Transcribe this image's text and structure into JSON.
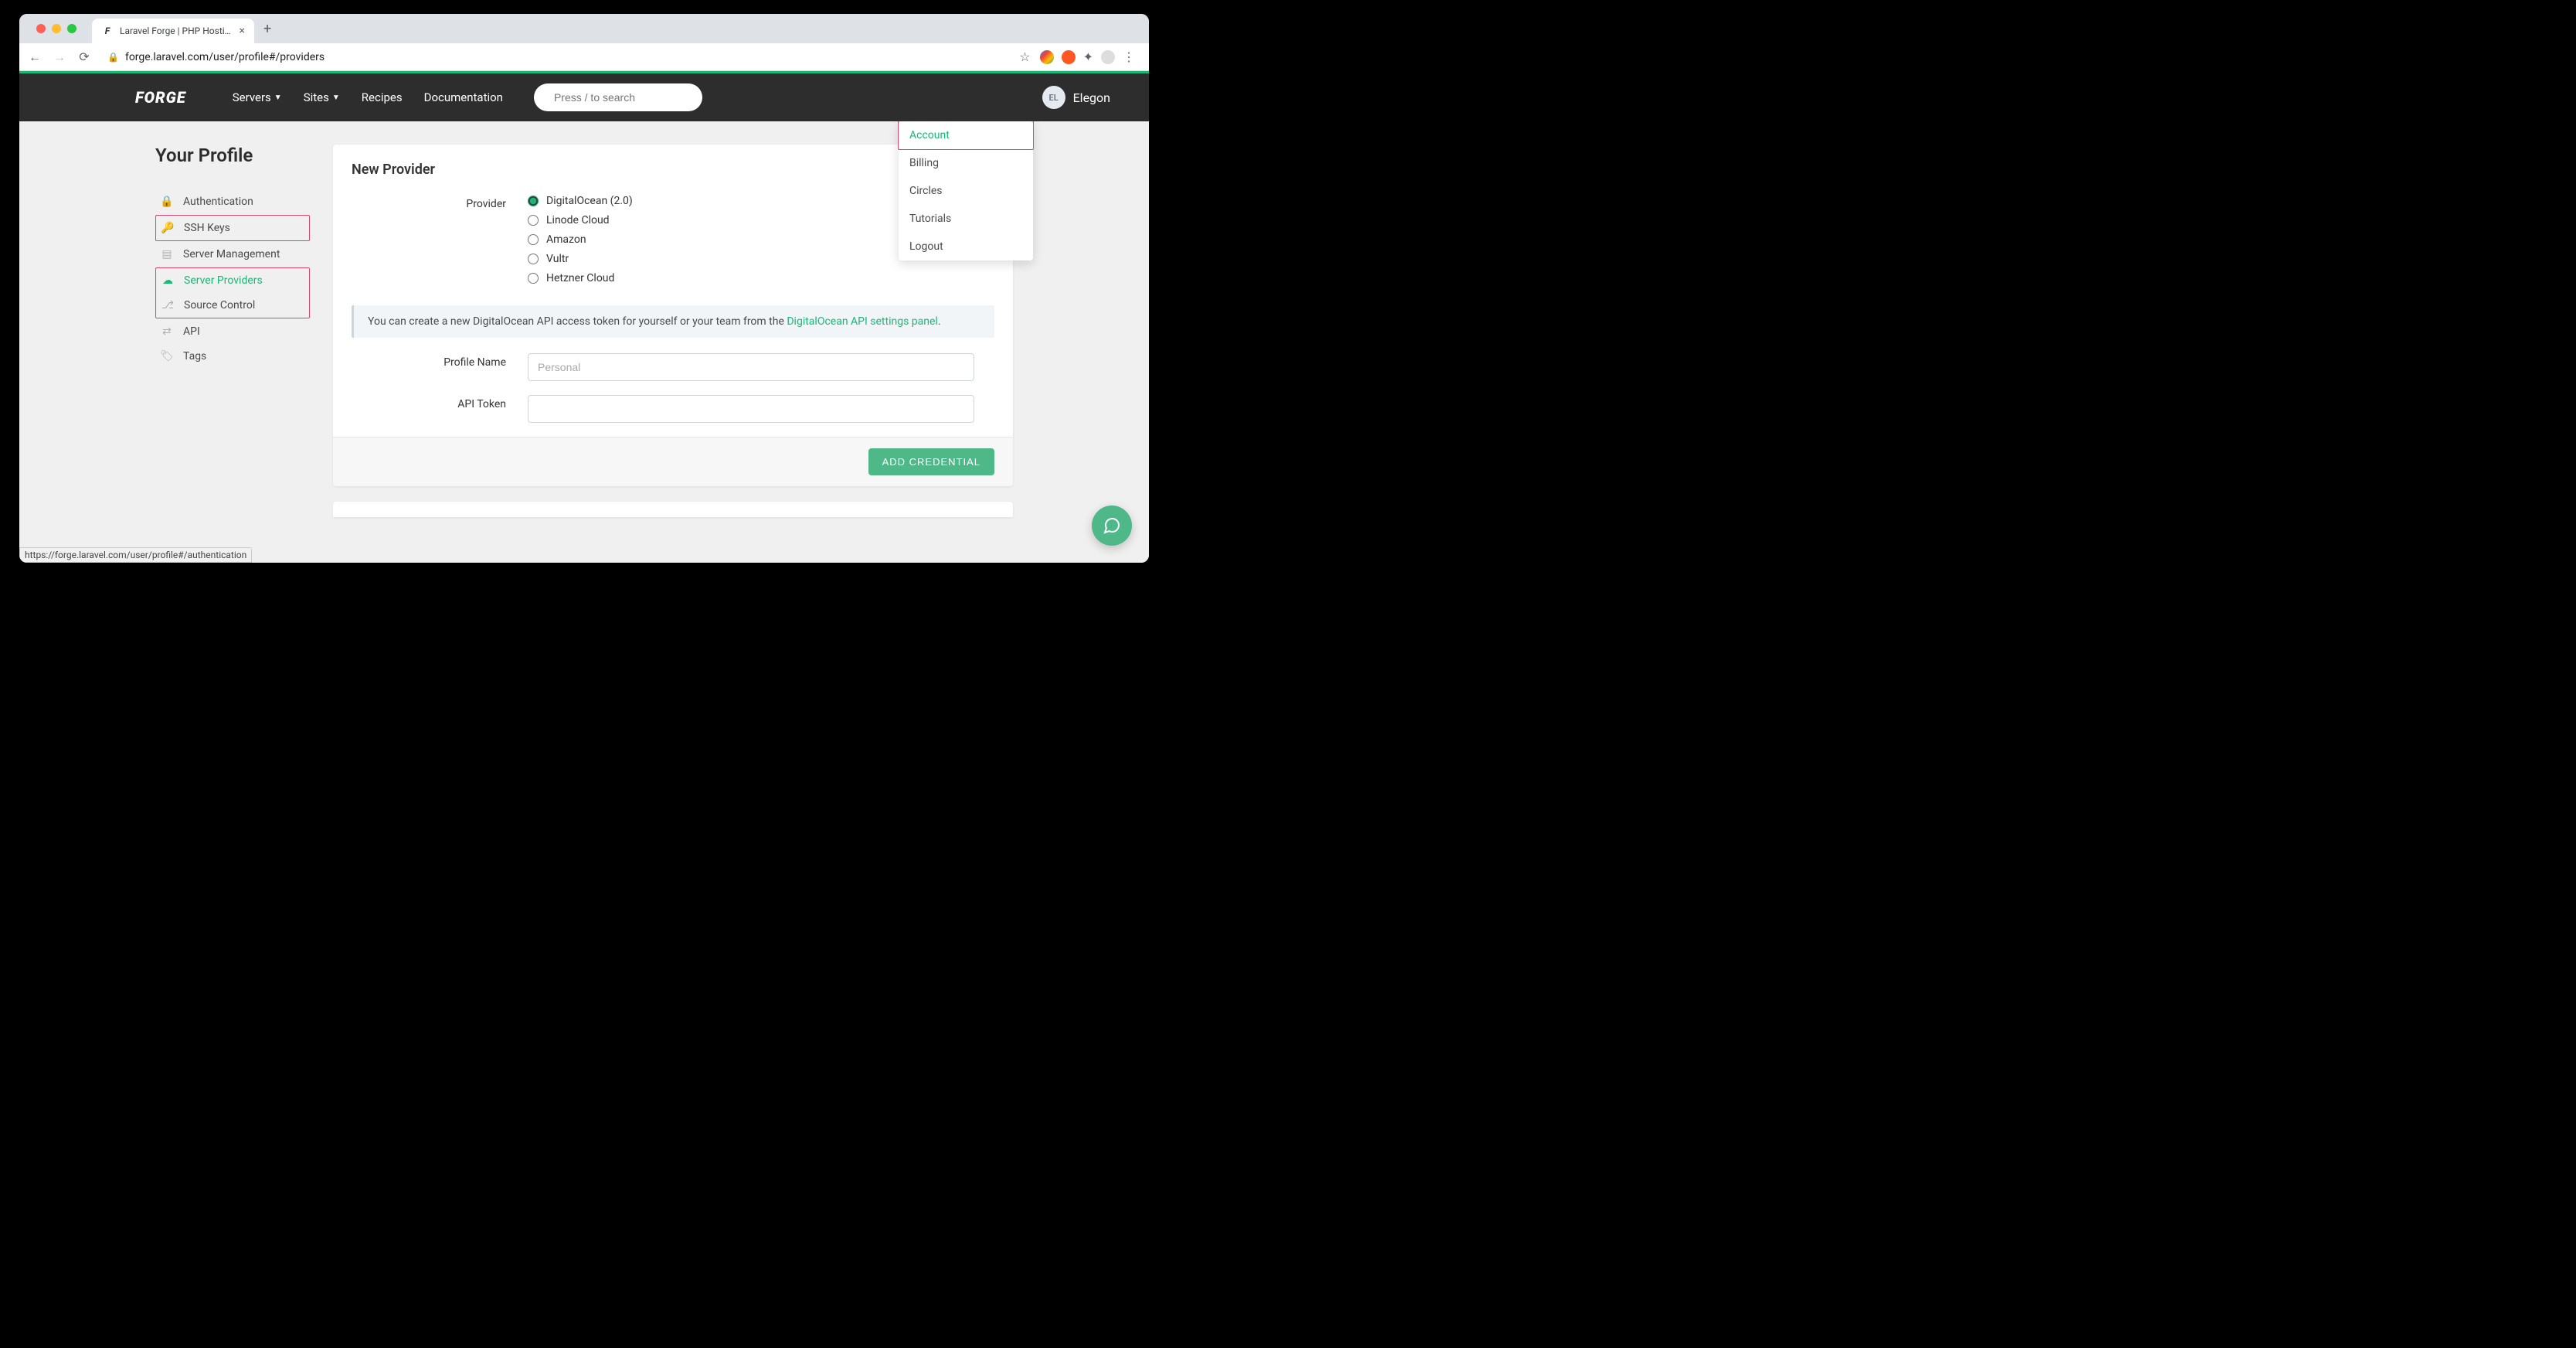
{
  "browser": {
    "tab_title": "Laravel Forge | PHP Hosting Fo",
    "url": "forge.laravel.com/user/profile#/providers",
    "status_url": "https://forge.laravel.com/user/profile#/authentication"
  },
  "topnav": {
    "logo": "FORGE",
    "links": {
      "servers": "Servers",
      "sites": "Sites",
      "recipes": "Recipes",
      "documentation": "Documentation"
    },
    "search_placeholder": "Press / to search",
    "user_initials": "EL",
    "user_name": "Elegon"
  },
  "dropdown": {
    "account": "Account",
    "billing": "Billing",
    "circles": "Circles",
    "tutorials": "Tutorials",
    "logout": "Logout"
  },
  "sidebar": {
    "title": "Your Profile",
    "items": {
      "authentication": "Authentication",
      "ssh_keys": "SSH Keys",
      "server_management": "Server Management",
      "server_providers": "Server Providers",
      "source_control": "Source Control",
      "api": "API",
      "tags": "Tags"
    }
  },
  "form": {
    "card_title": "New Provider",
    "provider_label": "Provider",
    "providers": {
      "digitalocean": "DigitalOcean (2.0)",
      "linode": "Linode Cloud",
      "amazon": "Amazon",
      "vultr": "Vultr",
      "hetzner": "Hetzner Cloud"
    },
    "info_text": "You can create a new DigitalOcean API access token for yourself or your team from the ",
    "info_link": "DigitalOcean API settings panel",
    "profile_name_label": "Profile Name",
    "profile_name_placeholder": "Personal",
    "api_token_label": "API Token",
    "submit_label": "ADD CREDENTIAL"
  }
}
